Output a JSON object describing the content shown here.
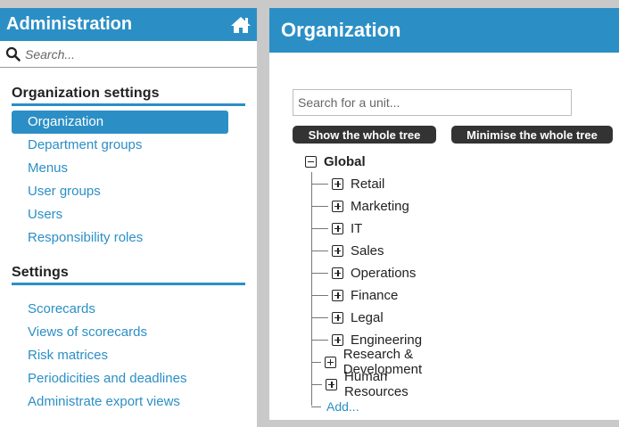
{
  "sidebar": {
    "title": "Administration",
    "home_icon": "home-icon",
    "search_placeholder": "Search...",
    "sections": [
      {
        "title": "Organization settings",
        "items": [
          "Organization",
          "Department groups",
          "Menus",
          "User groups",
          "Users",
          "Responsibility roles"
        ],
        "active": "Organization"
      },
      {
        "title": "Settings",
        "items": [
          "Scorecards",
          "Views of scorecards",
          "Risk matrices",
          "Periodicities and deadlines",
          "Administrate export views"
        ]
      }
    ]
  },
  "main": {
    "title": "Organization",
    "unit_search_placeholder": "Search for a unit...",
    "show_tree_label": "Show the whole tree",
    "minimise_tree_label": "Minimise the whole tree",
    "tree": {
      "root": "Global",
      "children": [
        "Retail",
        "Marketing",
        "IT",
        "Sales",
        "Operations",
        "Finance",
        "Legal",
        "Engineering",
        "Research & Development",
        "Human Resources"
      ],
      "add_label": "Add..."
    }
  },
  "colors": {
    "accent": "#2b8fc6",
    "button_dark": "#333333",
    "background": "#c9c9c9"
  }
}
